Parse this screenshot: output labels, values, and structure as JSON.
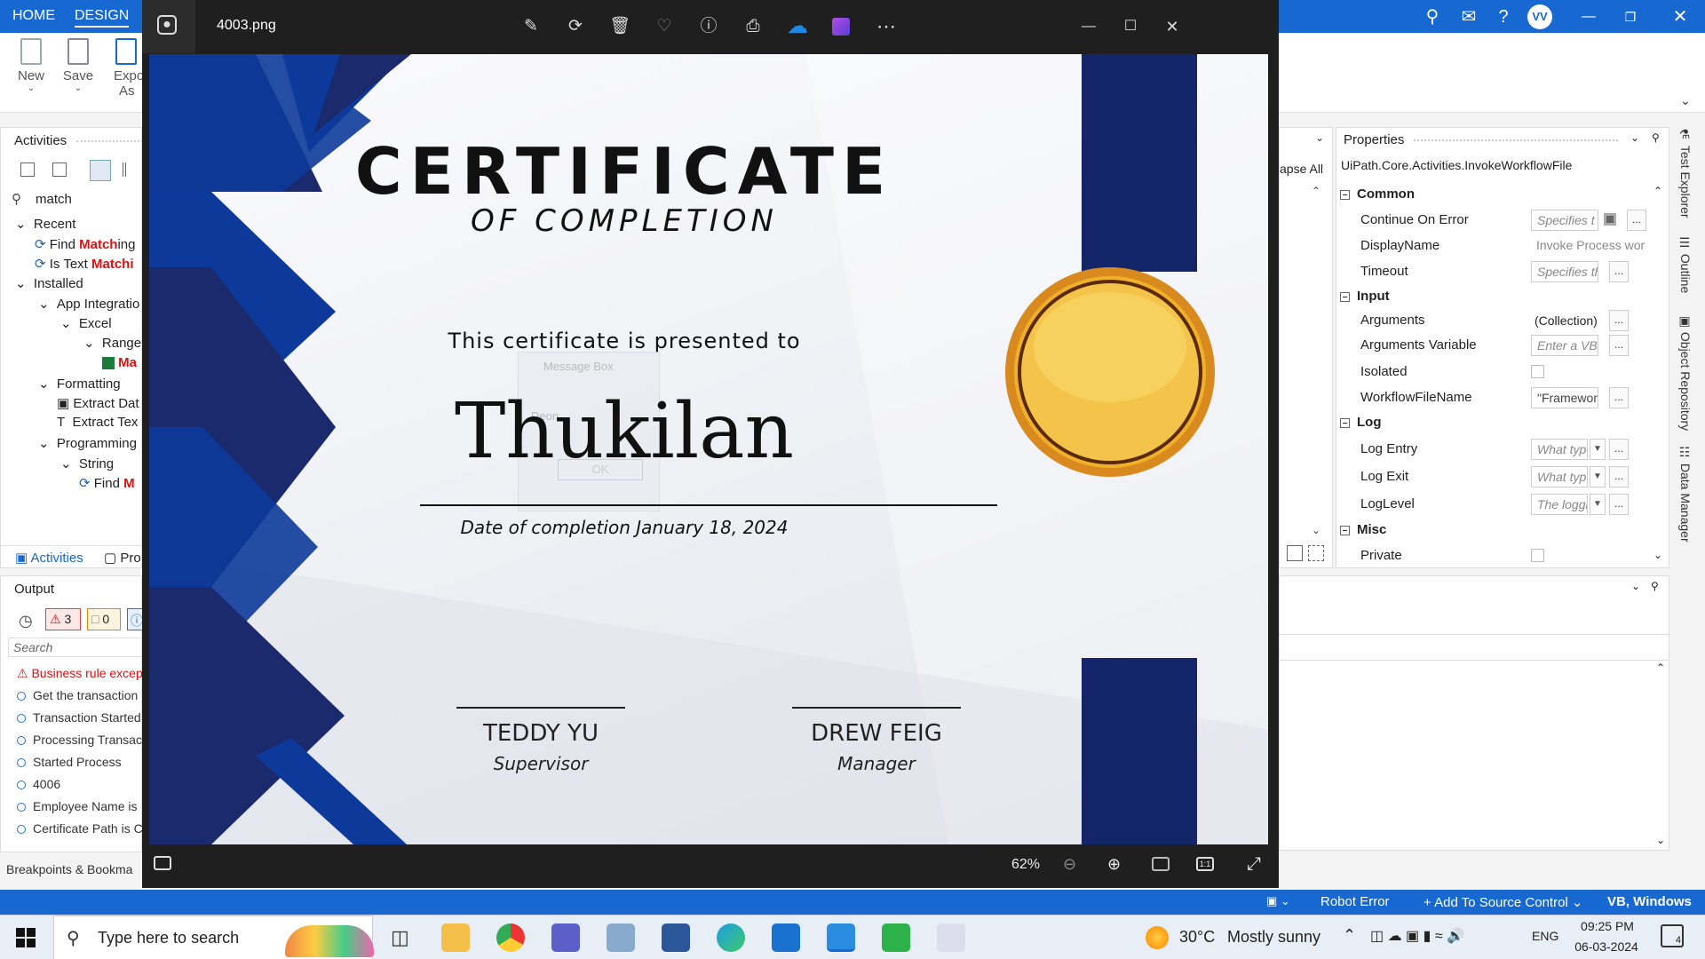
{
  "studio": {
    "tabs": [
      "HOME",
      "DESIGN"
    ],
    "avatar": "VV",
    "ribbon": {
      "new_label": "New",
      "save_label": "Save",
      "export_label": "Expo",
      "export_label2": "As"
    },
    "activities": {
      "title": "Activities",
      "search_value": "match",
      "tree": [
        {
          "label": "Recent",
          "level": 0
        },
        {
          "label_pre": "Find ",
          "label_hl": "Match",
          "label_post": "ing",
          "level": 1
        },
        {
          "label_pre": "Is Text ",
          "label_hl": "Matchi",
          "label_post": "",
          "level": 1
        },
        {
          "label": "Installed",
          "level": 0
        },
        {
          "label": "App Integratio",
          "level": 1
        },
        {
          "label": "Excel",
          "level": 2
        },
        {
          "label": "Range",
          "level": 3
        },
        {
          "label_hl": "Ma",
          "level": 4
        },
        {
          "label": "Formatting",
          "level": 1
        },
        {
          "label": "Extract Dat",
          "level": 2
        },
        {
          "label": "Extract Tex",
          "level": 2
        },
        {
          "label": "Programming",
          "level": 1
        },
        {
          "label": "String",
          "level": 2
        },
        {
          "label_pre": "Find ",
          "label_hl": "M",
          "level": 3
        }
      ],
      "bottom_tabs": [
        "Activities",
        "Pro"
      ]
    },
    "output": {
      "title": "Output",
      "error_count": "3",
      "warning_count": "0",
      "search_placeholder": "Search",
      "lines": [
        "Business rule excep",
        "Get the transaction",
        "Transaction Started",
        "Processing Transac",
        "Started Process",
        "4006",
        "Employee Name is",
        "Certificate Path is C"
      ],
      "footer": "Breakpoints & Bookma"
    },
    "designer": {
      "collapse_all": "apse All"
    },
    "properties": {
      "title": "Properties",
      "activity_type": "UiPath.Core.Activities.InvokeWorkflowFile",
      "categories": {
        "common": "Common",
        "input": "Input",
        "log": "Log",
        "misc": "Misc"
      },
      "rows": {
        "continue_on_error": {
          "label": "Continue On Error",
          "value": "Specifies t"
        },
        "display_name": {
          "label": "DisplayName",
          "value": "Invoke Process wor"
        },
        "timeout": {
          "label": "Timeout",
          "value": "Specifies the a"
        },
        "arguments": {
          "label": "Arguments",
          "value": "(Collection)"
        },
        "arguments_variable": {
          "label": "Arguments Variable",
          "value": "Enter a VB exp"
        },
        "isolated": {
          "label": "Isolated"
        },
        "workflow_file_name": {
          "label": "WorkflowFileName",
          "value": "\"Framework\\P"
        },
        "log_entry": {
          "label": "Log Entry",
          "value": "What type"
        },
        "log_exit": {
          "label": "Log Exit",
          "value": "What type"
        },
        "log_level": {
          "label": "LogLevel",
          "value": "The loggin"
        },
        "private": {
          "label": "Private"
        }
      },
      "dots": "..."
    },
    "side_tabs": [
      "Test Explorer",
      "Outline",
      "Object Repository",
      "Data Manager"
    ],
    "statusbar": {
      "robot_error": "Robot Error",
      "add_source": "Add To Source Control",
      "language": "VB, Windows"
    }
  },
  "photo_viewer": {
    "filename": "4003.png",
    "zoom": "62%",
    "certificate": {
      "title": "CERTIFICATE",
      "subtitle": "OF COMPLETION",
      "presented": "This certificate is presented to",
      "name": "Thukilan",
      "date_line": "Date of completion January 18, 2024",
      "sig1_name": "TEDDY YU",
      "sig1_role": "Supervisor",
      "sig2_name": "DREW FEIG",
      "sig2_role": "Manager",
      "ghost_title": "Message Box",
      "ghost_text": "Deon",
      "ghost_ok": "OK"
    },
    "colors": {
      "navy": "#1a2a6c",
      "royal": "#0d3a9a",
      "gold": "#f0b02a"
    }
  },
  "taskbar": {
    "search_placeholder": "Type here to search",
    "weather_temp": "30°C",
    "weather_desc": "Mostly sunny",
    "lang": "ENG",
    "time": "09:25 PM",
    "date": "06-03-2024",
    "notif_count": "4"
  }
}
